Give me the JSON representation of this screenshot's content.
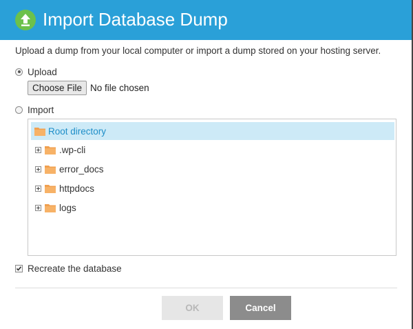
{
  "dialog": {
    "title": "Import Database Dump",
    "intro": "Upload a dump from your local computer or import a dump stored on your hosting server.",
    "header_color": "#2aa0d8",
    "header_icon": "upload-arrow-icon"
  },
  "upload_option": {
    "label": "Upload",
    "selected": true,
    "choose_file_label": "Choose File",
    "file_status": "No file chosen"
  },
  "import_option": {
    "label": "Import",
    "selected": false
  },
  "tree": {
    "root": {
      "label": "Root directory",
      "icon": "folder-icon"
    },
    "items": [
      {
        "label": ".wp-cli",
        "icon": "folder-icon"
      },
      {
        "label": "error_docs",
        "icon": "folder-icon"
      },
      {
        "label": "httpdocs",
        "icon": "folder-icon"
      },
      {
        "label": "logs",
        "icon": "folder-icon"
      }
    ]
  },
  "recreate": {
    "label": "Recreate the database",
    "checked": true
  },
  "buttons": {
    "ok": "OK",
    "cancel": "Cancel"
  }
}
